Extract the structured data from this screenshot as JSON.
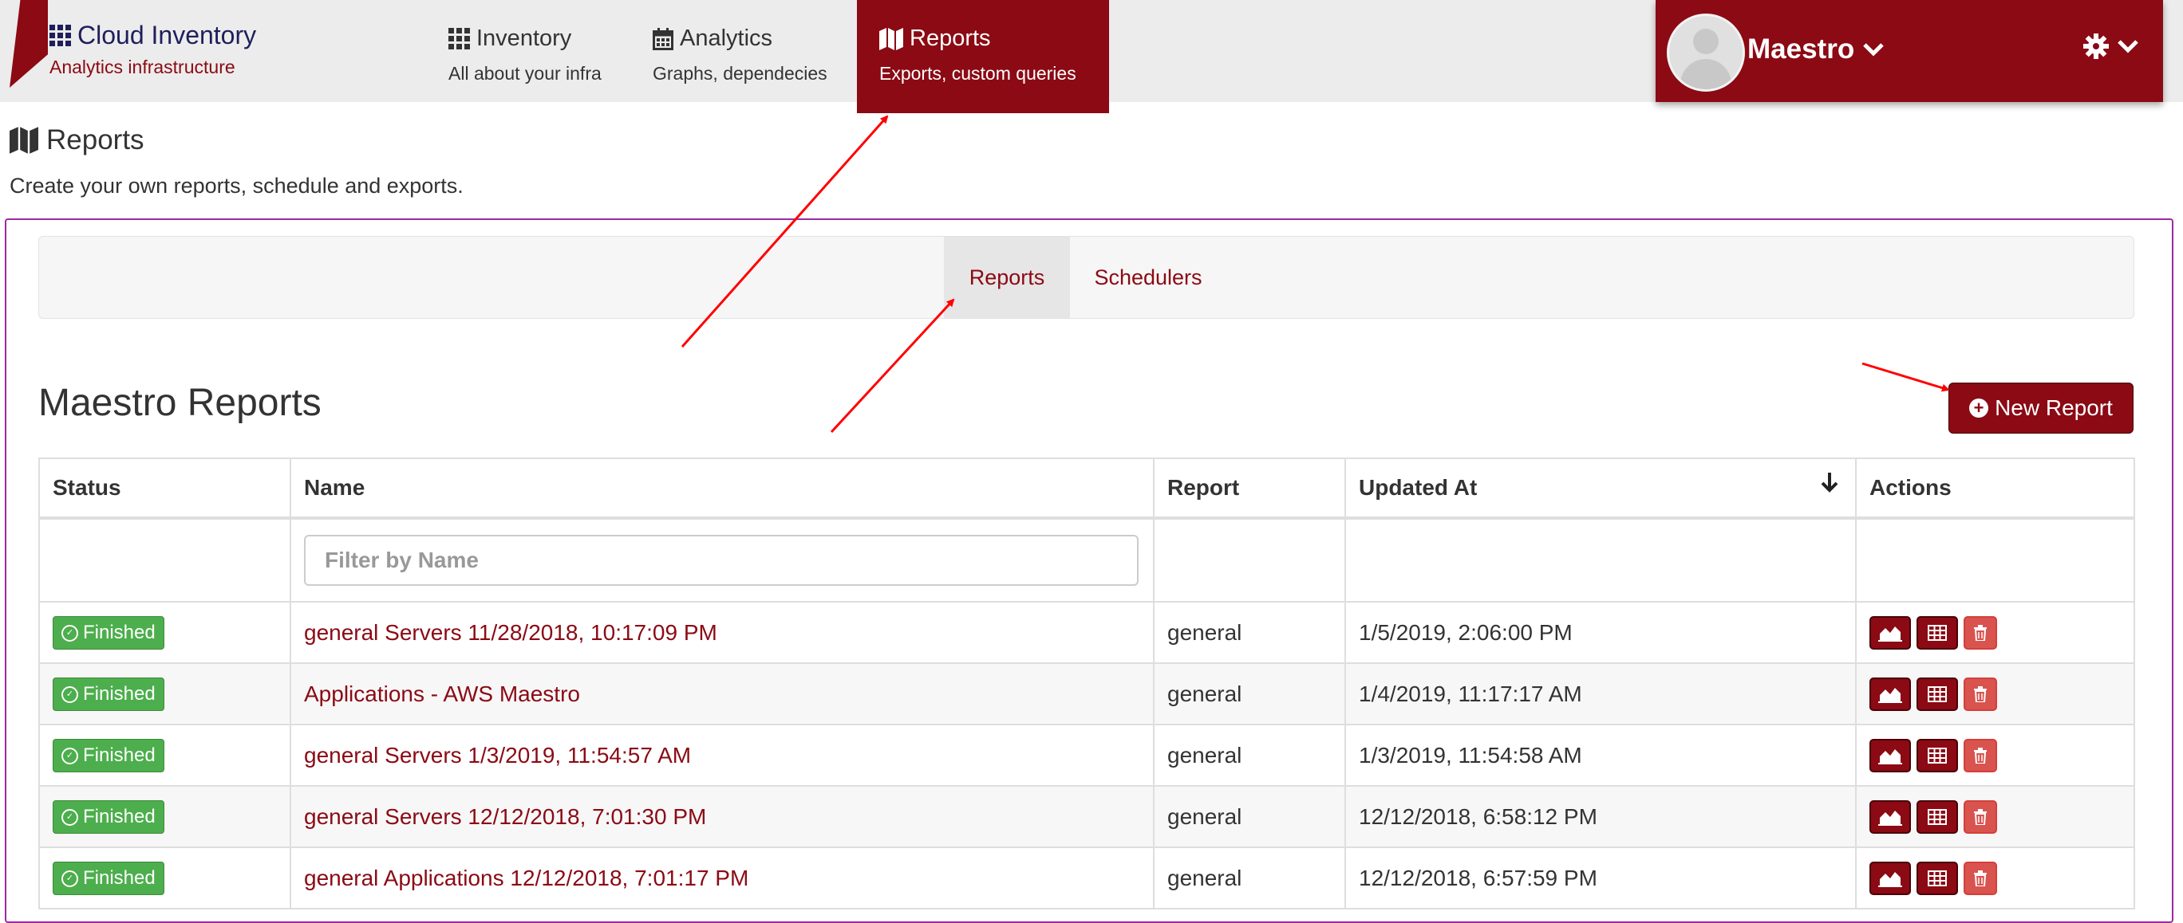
{
  "brand": {
    "title": "Cloud Inventory",
    "subtitle": "Analytics infrastructure"
  },
  "nav": [
    {
      "title": "Inventory",
      "subtitle": "All about your infra",
      "icon": "grid-icon"
    },
    {
      "title": "Analytics",
      "subtitle": "Graphs, dependecies",
      "icon": "calendar-icon"
    },
    {
      "title": "Reports",
      "subtitle": "Exports, custom queries",
      "icon": "map-icon",
      "active": true
    }
  ],
  "user": {
    "name": "Maestro"
  },
  "page": {
    "title": "Reports",
    "description": "Create your own reports, schedule and exports."
  },
  "tabs": [
    {
      "label": "Reports",
      "active": true
    },
    {
      "label": "Schedulers",
      "active": false
    }
  ],
  "section": {
    "title": "Maestro Reports",
    "new_button_label": "New Report"
  },
  "table": {
    "headers": [
      "Status",
      "Name",
      "Report",
      "Updated At",
      "Actions"
    ],
    "filter_placeholder": "Filter by Name",
    "rows": [
      {
        "status": "Finished",
        "name": "general Servers 11/28/2018, 10:17:09 PM",
        "report": "general",
        "updated": "1/5/2019, 2:06:00 PM"
      },
      {
        "status": "Finished",
        "name": "Applications - AWS Maestro",
        "report": "general",
        "updated": "1/4/2019, 11:17:17 AM"
      },
      {
        "status": "Finished",
        "name": "general Servers 1/3/2019, 11:54:57 AM",
        "report": "general",
        "updated": "1/3/2019, 11:54:58 AM"
      },
      {
        "status": "Finished",
        "name": "general Servers 12/12/2018, 7:01:30 PM",
        "report": "general",
        "updated": "12/12/2018, 6:58:12 PM"
      },
      {
        "status": "Finished",
        "name": "general Applications 12/12/2018, 7:01:17 PM",
        "report": "general",
        "updated": "12/12/2018, 6:57:59 PM"
      }
    ]
  },
  "colors": {
    "brand": "#8b0a14",
    "success": "#4cae4c",
    "danger": "#d9534f",
    "annotation": "#ff0000",
    "panel_border": "#9b2aa0"
  }
}
